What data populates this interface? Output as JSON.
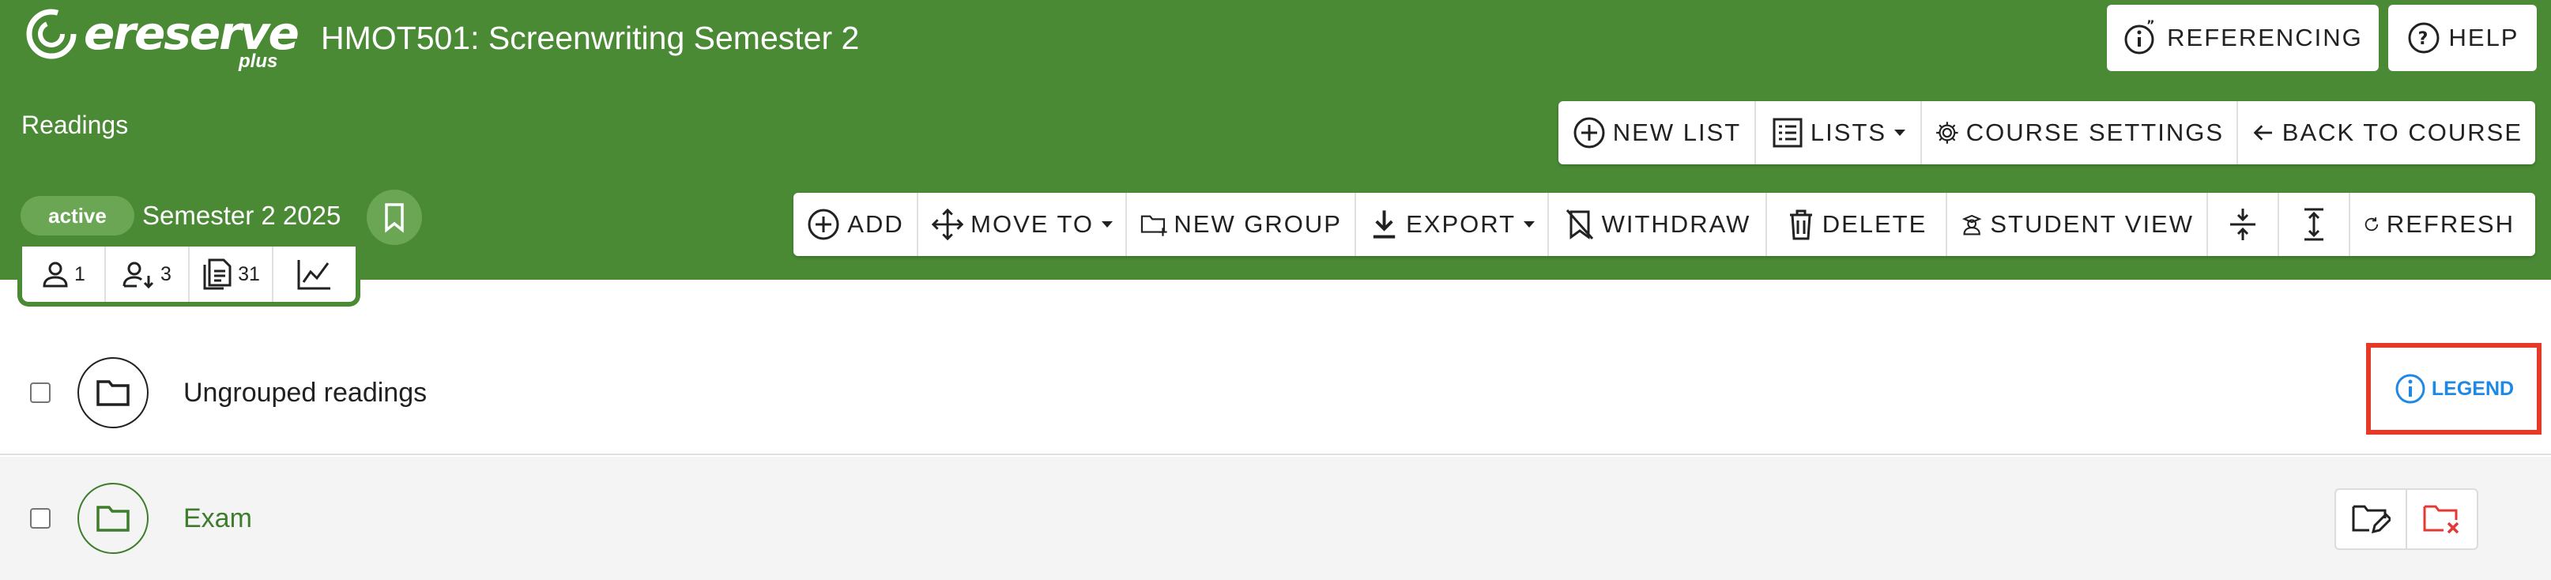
{
  "header": {
    "logo_text": "ereserve",
    "logo_plus": "plus",
    "course_title": "HMOT501: Screenwriting Semester 2",
    "page_label": "Readings",
    "status_badge": "active",
    "semester": "Semester 2 2025"
  },
  "top_buttons": {
    "referencing": "REFERENCING",
    "help": "HELP"
  },
  "nav_toolbar": {
    "new_list": "NEW LIST",
    "lists": "LISTS",
    "course_settings": "COURSE SETTINGS",
    "back_to_course": "BACK TO COURSE"
  },
  "action_toolbar": {
    "add": "ADD",
    "move_to": "MOVE TO",
    "new_group": "NEW GROUP",
    "export": "EXPORT",
    "withdraw": "WITHDRAW",
    "delete": "DELETE",
    "student_view": "STUDENT VIEW",
    "refresh": "REFRESH"
  },
  "stats": {
    "owners": "1",
    "students": "3",
    "readings": "31"
  },
  "groups": [
    {
      "label": "Ungrouped readings"
    },
    {
      "label": "Exam"
    }
  ],
  "legend_label": "LEGEND",
  "colors": {
    "header_bg": "#4a8a35",
    "badge_bg": "#6aa654",
    "legend_blue": "#1e88e5",
    "highlight_red": "#e53a27",
    "exam_green": "#3d7d2b"
  }
}
